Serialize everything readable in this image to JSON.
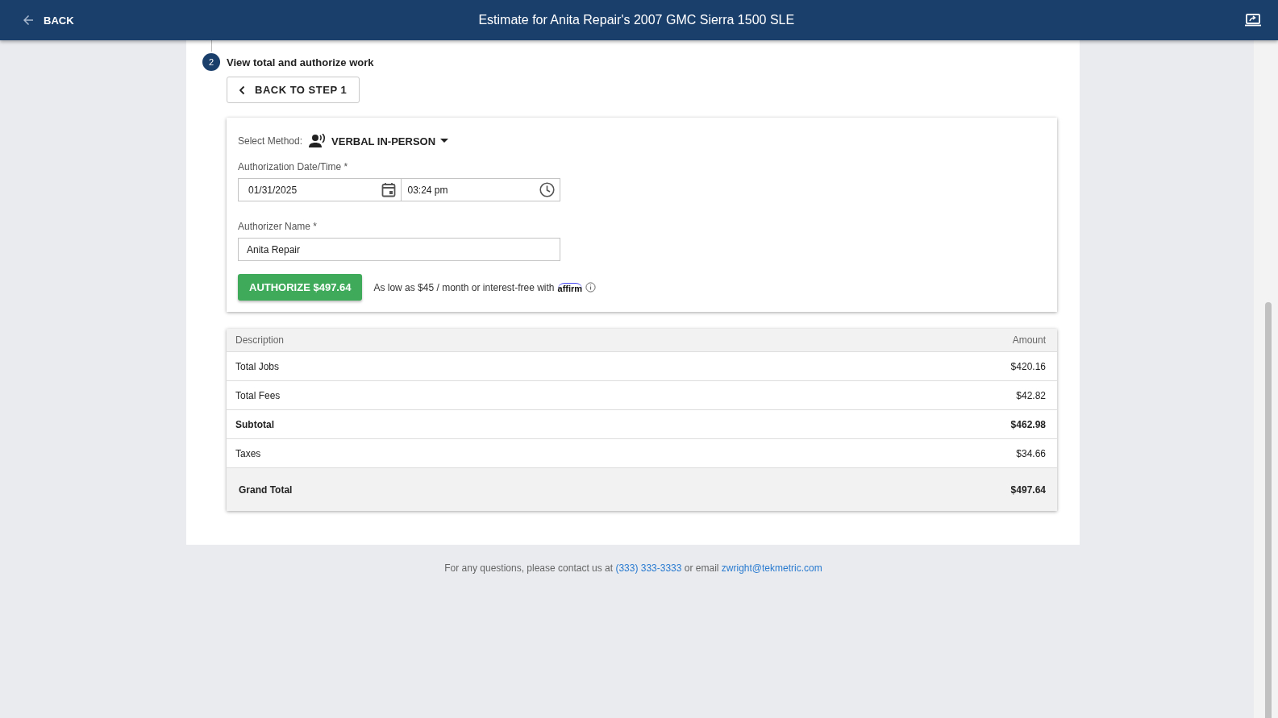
{
  "header": {
    "back_label": "BACK",
    "title": "Estimate for Anita Repair's 2007 GMC Sierra 1500 SLE"
  },
  "step": {
    "number": "2",
    "title": "View total and authorize work",
    "back_button": "BACK TO STEP 1"
  },
  "authorization": {
    "method_label": "Select Method:",
    "method_value": "VERBAL IN-PERSON",
    "datetime_label": "Authorization Date/Time *",
    "date": "01/31/2025",
    "time": "03:24 pm",
    "name_label": "Authorizer Name *",
    "name_value": "Anita Repair",
    "authorize_button": "AUTHORIZE $497.64",
    "financing_text": "As low as $45 / month or interest-free with",
    "financing_logo": "affirm"
  },
  "table": {
    "columns": [
      "Description",
      "Amount"
    ],
    "rows": [
      {
        "kind": "normal",
        "description": "Total Jobs",
        "amount": "$420.16"
      },
      {
        "kind": "normal",
        "description": "Total Fees",
        "amount": "$42.82"
      },
      {
        "kind": "bold",
        "description": "Subtotal",
        "amount": "$462.98"
      },
      {
        "kind": "normal",
        "description": "Taxes",
        "amount": "$34.66"
      },
      {
        "kind": "total",
        "description": "Grand Total",
        "amount": "$497.64"
      }
    ]
  },
  "footer": {
    "text": "For any questions, please contact us at",
    "phone": "(333) 333-3333",
    "middle": "or email",
    "email": "zwright@tekmetric.com"
  }
}
